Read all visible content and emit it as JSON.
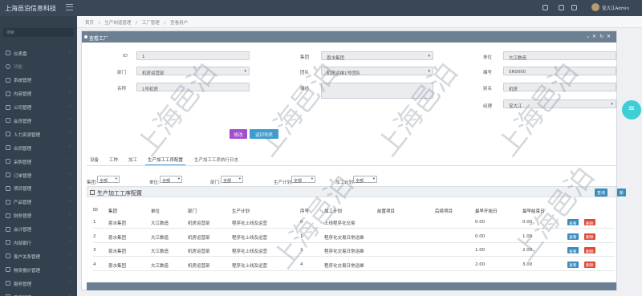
{
  "app": {
    "brand": "上海邑泊信息科技",
    "user": "宝大江Admin"
  },
  "sidebar": {
    "search_placeholder": "搜索",
    "items": [
      {
        "label": "仪表盘",
        "chevron": "›",
        "icon": "dashboard-icon"
      },
      {
        "label": "功能",
        "chevron": "",
        "icon": "section-icon",
        "section": true
      },
      {
        "label": "系统管理",
        "chevron": "‹",
        "icon": "system-icon"
      },
      {
        "label": "内容管理",
        "chevron": "‹",
        "icon": "content-icon"
      },
      {
        "label": "公司管理",
        "chevron": "‹",
        "icon": "company-icon"
      },
      {
        "label": "会员管理",
        "chevron": "‹",
        "icon": "member-icon"
      },
      {
        "label": "人力资源管理",
        "chevron": "‹",
        "icon": "hr-icon"
      },
      {
        "label": "合同管理",
        "chevron": "‹",
        "icon": "contract-icon"
      },
      {
        "label": "采购管理",
        "chevron": "‹",
        "icon": "purchase-icon"
      },
      {
        "label": "订单管理",
        "chevron": "‹",
        "icon": "order-icon"
      },
      {
        "label": "项目管理",
        "chevron": "‹",
        "icon": "project-icon"
      },
      {
        "label": "产品管理",
        "chevron": "‹",
        "icon": "product-icon"
      },
      {
        "label": "财务管理",
        "chevron": "‹",
        "icon": "finance-icon"
      },
      {
        "label": "会计管理",
        "chevron": "‹",
        "icon": "accounting-icon"
      },
      {
        "label": "内部银行",
        "chevron": "‹",
        "icon": "bank-icon"
      },
      {
        "label": "客户关系管理",
        "chevron": "‹",
        "icon": "crm-icon"
      },
      {
        "label": "物资报价管理",
        "chevron": "‹",
        "icon": "quote-icon"
      },
      {
        "label": "服务管理",
        "chevron": "‹",
        "icon": "service-icon"
      },
      {
        "label": "资产管理",
        "chevron": "‹",
        "icon": "asset-icon"
      }
    ]
  },
  "breadcrumb": [
    "首页",
    "生产制造管理",
    "工厂管理",
    "查看用户"
  ],
  "panel": {
    "title": "查看工厂",
    "controls": [
      "⌄",
      "✕",
      "↻",
      "✕"
    ]
  },
  "form": {
    "id_label": "ID",
    "id_value": "1",
    "group_label": "集团",
    "group_value": "恩水集团",
    "company_label": "单位",
    "company_value": "大江数造",
    "dept_label": "部门",
    "dept_value": "机房运营部",
    "team_label": "团队",
    "team_value": "机房运维1号团队",
    "code_label": "编号",
    "code_value": "SR0000",
    "name_label": "名称",
    "name_value": "1号机房",
    "desc_label": "描述",
    "desc_value": "",
    "alias_label": "别名",
    "alias_value": "机房",
    "owner_label": "经理",
    "owner_value": "宝大江"
  },
  "actions": {
    "edit": "修改",
    "back": "返回列表"
  },
  "tabs": [
    "设备",
    "工种",
    "加工",
    "生产加工工序配置",
    "生产加工工序执行日志"
  ],
  "filters": [
    {
      "label": "集团:",
      "value": "全部"
    },
    {
      "label": "单位:",
      "value": "全部"
    },
    {
      "label": "部门:",
      "value": "全部"
    },
    {
      "label": "生产计划:",
      "value": "全部"
    },
    {
      "label": "加工计划:",
      "value": "全部"
    }
  ],
  "section": {
    "title": "生产加工工序配置",
    "query": "查询",
    "add": "新增"
  },
  "table": {
    "headers": [
      "ID",
      "集团",
      "单位",
      "部门",
      "生产计划",
      "序号",
      "加工计划",
      "前置项目",
      "后续项目",
      "最早开始日",
      "最早结束日"
    ],
    "rows": [
      [
        "1",
        "恩水集团",
        "大江数造",
        "机房运营部",
        "程序化上线及运营",
        "0",
        "上线程序化交易",
        "",
        "",
        "0.00",
        "0.00"
      ],
      [
        "2",
        "恩水集团",
        "大江数造",
        "机房运营部",
        "程序化上线及运营",
        "1",
        "程序化交易日常运维",
        "",
        "",
        "0.00",
        "1.00"
      ],
      [
        "3",
        "恩水集团",
        "大江数造",
        "机房运营部",
        "程序化上线及运营",
        "3",
        "程序化交易日常运维",
        "",
        "",
        "1.00",
        "2.00"
      ],
      [
        "4",
        "恩水集团",
        "大江数造",
        "机房运营部",
        "程序化上线及运营",
        "4",
        "程序化交易日常运维",
        "",
        "",
        "2.00",
        "3.00"
      ]
    ],
    "view_label": "查看",
    "delete_label": "删除"
  },
  "watermark": "上海邑泊",
  "colors": {
    "primary": "#3c8dbc",
    "danger": "#dd4b39",
    "edit": "#a34dd1",
    "back": "#3c9dd0",
    "header": "#6d7f92",
    "fab": "#3ecfd6"
  }
}
